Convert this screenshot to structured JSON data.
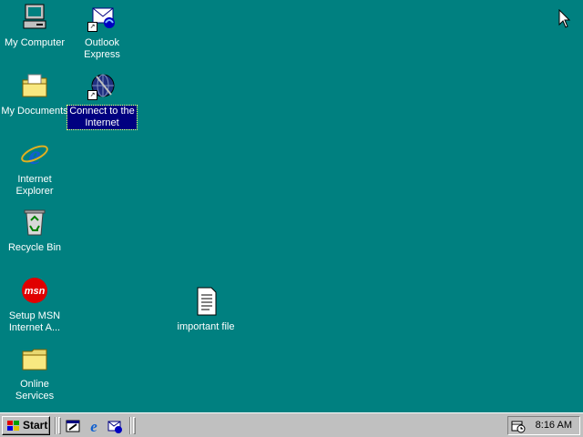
{
  "desktop": {
    "icons": [
      {
        "label": "My Computer"
      },
      {
        "label": "Outlook Express"
      },
      {
        "label": "My Documents"
      },
      {
        "label": "Connect to the Internet"
      },
      {
        "label": "Internet Explorer"
      },
      {
        "label": "Recycle Bin"
      },
      {
        "label": "Setup MSN Internet A..."
      },
      {
        "label": "Online Services"
      },
      {
        "label": "important file"
      }
    ],
    "background_color": "#008080"
  },
  "taskbar": {
    "start_label": "Start",
    "clock": "8:16 AM",
    "quick_launch": [
      "show-desktop-icon",
      "internet-explorer-icon",
      "outlook-express-icon"
    ]
  }
}
